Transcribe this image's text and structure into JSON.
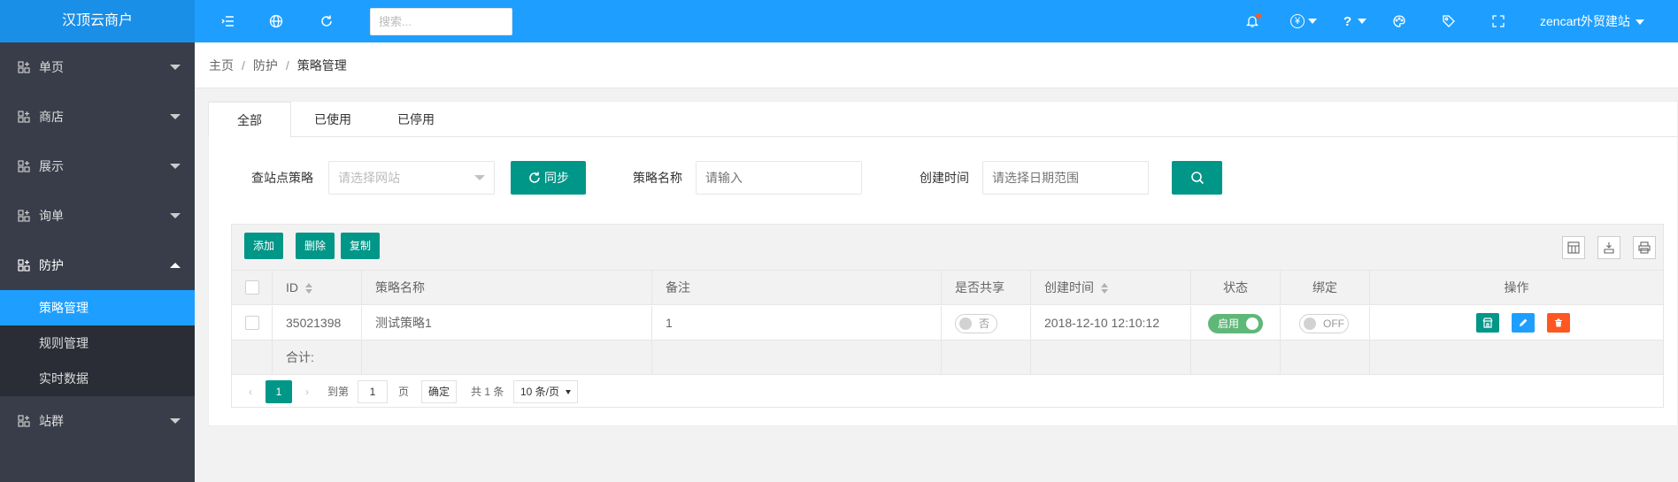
{
  "app": {
    "title": "汉顶云商户"
  },
  "topbar": {
    "search_placeholder": "搜索...",
    "user_label": "zencart外贸建站",
    "icons": [
      "menu-toggle-icon",
      "globe-icon",
      "refresh-icon",
      "bell-icon",
      "currency-icon",
      "help-icon",
      "palette-icon",
      "tag-icon",
      "fullscreen-icon"
    ],
    "currency_symbol": "¥",
    "help_symbol": "?"
  },
  "sidebar": {
    "items": [
      {
        "label": "单页"
      },
      {
        "label": "商店"
      },
      {
        "label": "展示"
      },
      {
        "label": "询单"
      },
      {
        "label": "防护"
      },
      {
        "label": "站群"
      }
    ],
    "subitems": [
      {
        "label": "策略管理",
        "active": true
      },
      {
        "label": "规则管理"
      },
      {
        "label": "实时数据"
      }
    ]
  },
  "breadcrumb": {
    "home": "主页",
    "section": "防护",
    "current": "策略管理",
    "separator": "/"
  },
  "tabs": [
    {
      "label": "全部"
    },
    {
      "label": "已使用"
    },
    {
      "label": "已停用"
    }
  ],
  "filters": {
    "site_label": "查站点策略",
    "site_placeholder": "请选择网站",
    "sync_label": "同步",
    "name_label": "策略名称",
    "name_placeholder": "请输入",
    "date_label": "创建时间",
    "date_placeholder": "请选择日期范围"
  },
  "toolbar": {
    "add": "添加",
    "delete": "删除",
    "copy": "复制"
  },
  "table": {
    "columns": [
      "ID",
      "策略名称",
      "备注",
      "是否共享",
      "创建时间",
      "状态",
      "绑定",
      "操作"
    ],
    "rows": [
      {
        "id": "35021398",
        "name": "测试策略1",
        "remark": "1",
        "shared": "否",
        "created": "2018-12-10 12:10:12",
        "status": "启用",
        "bind": "OFF"
      }
    ],
    "total_label": "合计:"
  },
  "pagination": {
    "current_page": "1",
    "goto_label": "到第",
    "page_input": "1",
    "page_unit": "页",
    "confirm": "确定",
    "total": "共 1 条",
    "page_size": "10 条/页"
  },
  "colors": {
    "primary": "#1e9fff",
    "green": "#009688",
    "sidebar": "#393d49",
    "switch_on": "#5fb878",
    "danger": "#ff5722"
  }
}
